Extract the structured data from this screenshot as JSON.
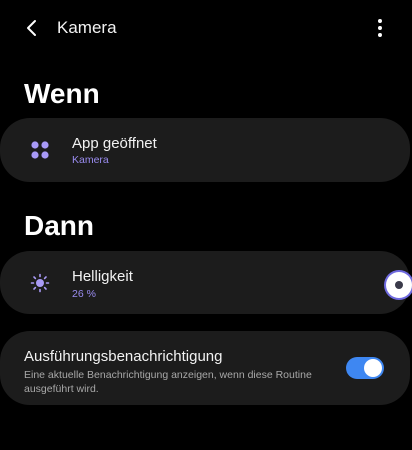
{
  "header": {
    "title": "Kamera",
    "back_icon": "chevron-left-icon",
    "more_icon": "more-vertical-icon"
  },
  "sections": {
    "when_heading": "Wenn",
    "then_heading": "Dann"
  },
  "when_card": {
    "title": "App geöffnet",
    "subtitle": "Kamera",
    "icon": "apps-grid-icon"
  },
  "then_card": {
    "title": "Helligkeit",
    "subtitle": "26 %",
    "icon": "brightness-icon"
  },
  "notification_card": {
    "title": "Ausführungsbenachrichtigung",
    "description": "Eine aktuelle Benachrichtigung anzeigen, wenn diese Routine ausgeführt wird.",
    "toggle_on": true
  },
  "colors": {
    "background": "#000000",
    "card": "#1c1c1c",
    "accent_purple": "#9a8cf0",
    "toggle_blue": "#3e87f2"
  }
}
